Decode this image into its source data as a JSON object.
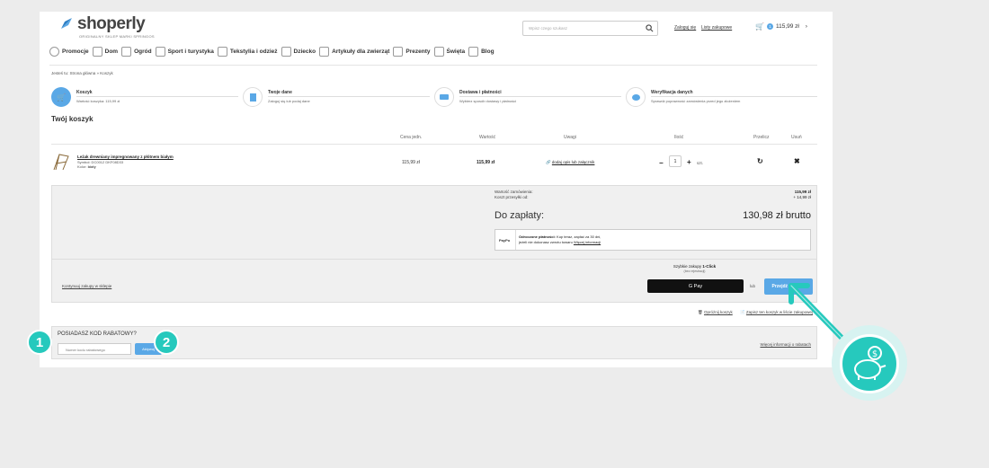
{
  "header": {
    "logo_name": "shoperly",
    "logo_sub": "ORIGINALNY SKLEP MARKI SPRINGOS",
    "search_placeholder": "Wpisz czego szukasz",
    "login_link": "Zaloguj się",
    "wishlist_link": "Listy zakupowe",
    "cart_count": "1",
    "cart_total": "115,99 zł"
  },
  "nav": [
    "Promocje",
    "Dom",
    "Ogród",
    "Sport i turystyka",
    "Tekstylia i odzież",
    "Dziecko",
    "Artykuły dla zwierząt",
    "Prezenty",
    "Święta",
    "Blog"
  ],
  "breadcrumb": {
    "prefix": "Jesteś tu:",
    "path": "Strona główna » Koszyk"
  },
  "steps": [
    {
      "title": "Koszyk",
      "sub": "Wartość koszyka: 115,99 zł"
    },
    {
      "title": "Twoje dane",
      "sub": "Zaloguj się lub podaj dane"
    },
    {
      "title": "Dostawa i płatności",
      "sub": "Wybierz sposób dostawy i płatności"
    },
    {
      "title": "Weryfikacja danych",
      "sub": "Sprawdź poprawność zamówienia przed jego złożeniem"
    }
  ],
  "cart_title": "Twój koszyk",
  "table": {
    "headers": [
      "Cena jedn.",
      "Wartość",
      "Uwagi",
      "Ilość",
      "Przelicz",
      "Usuń"
    ],
    "item": {
      "name": "Leżak drewniany impregnowany z płótnem białym",
      "symbol": "Symbol: DC0012 DKF08D33",
      "color_label": "Kolor:",
      "color_value": "biały",
      "unit_price": "115,99 zł",
      "value": "115,99 zł",
      "note_link": "dodaj opis lub załącznik",
      "qty": "1",
      "unit": "szt."
    }
  },
  "summary": {
    "order_value_label": "Wartość zamówienia:",
    "order_value": "115,99 zł",
    "shipping_label": "Koszt przesyłki od:",
    "shipping": "+ 14,99 zł",
    "total_label": "Do zapłaty:",
    "total": "130,98 zł brutto",
    "deferred_logo": "PayPo",
    "deferred_title": "Odroczone płatności:",
    "deferred_text1": "Kup teraz, zapłać za 30 dni,",
    "deferred_text2": "jeżeli nie dokonasz zwrotu towaru",
    "deferred_more": "Więcej informacji"
  },
  "checkout": {
    "continue_link": "Kontynuuj zakupy w sklepie",
    "quick_label": "Szybkie zakupy",
    "quick_bold": "1-Click",
    "quick_sub": "(bez rejestracji)",
    "gpay_label": "G Pay",
    "or_label": "lub",
    "proceed_label": "Przejdź dalej"
  },
  "cart_actions": {
    "clear": "Opróżnij koszyk",
    "save": "Zapisz ten koszyk w liście zakupowej"
  },
  "discount": {
    "title": "POSIADASZ KOD RABATOWY?",
    "placeholder": "Numer kodu rabatowego",
    "activate": "Aktywuj",
    "more": "Więcej informacji o rabatach"
  },
  "badges": [
    "1",
    "2"
  ],
  "colors": {
    "accent": "#5aa8e6",
    "teal": "#26c9bd",
    "background": "#ececec"
  }
}
